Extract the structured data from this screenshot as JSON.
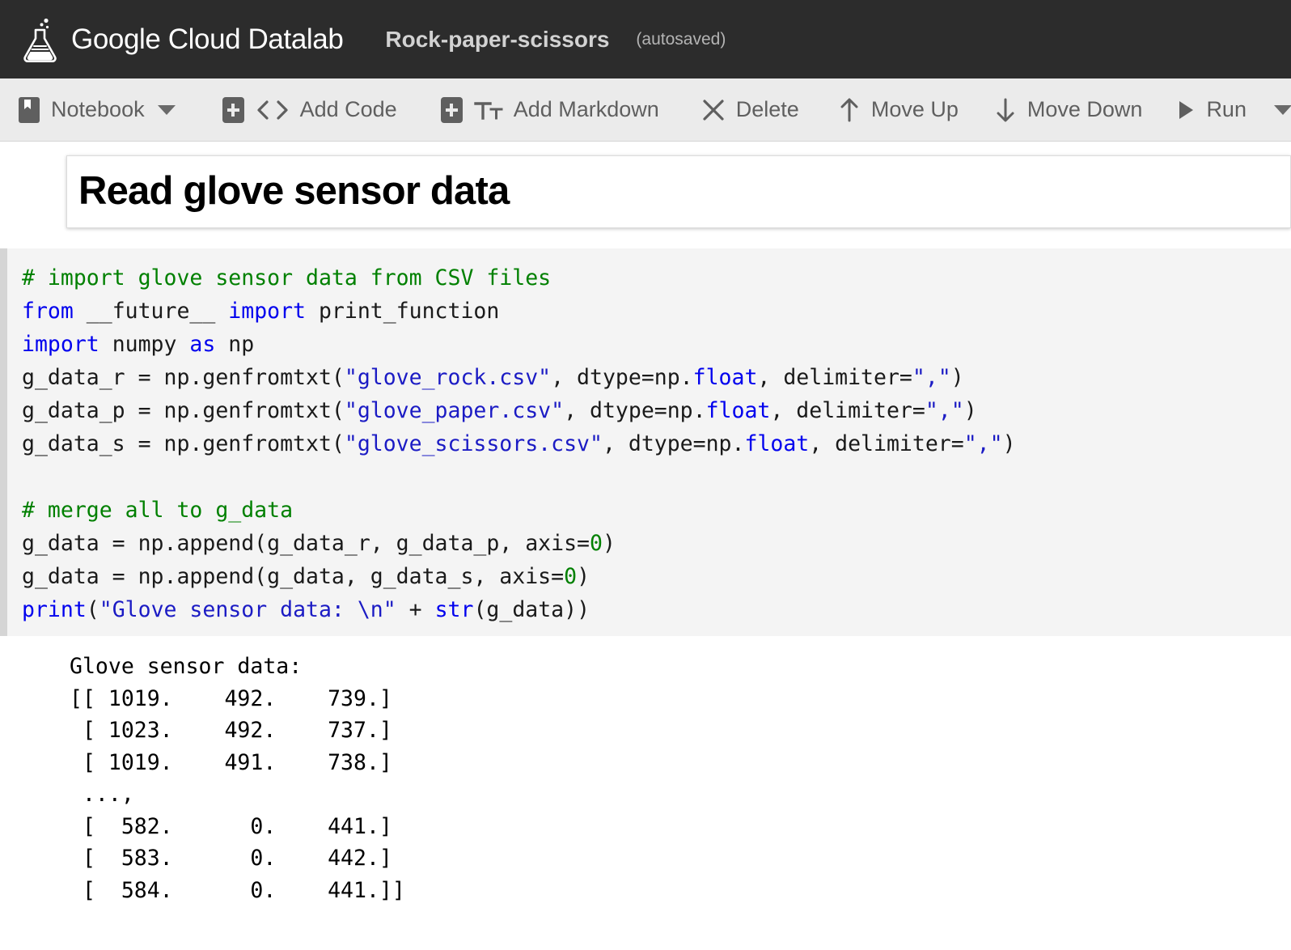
{
  "header": {
    "logo_icon": "flask-icon",
    "brand": "Google Cloud Datalab",
    "notebook_title": "Rock-paper-scissors",
    "autosaved": "(autosaved)",
    "bg_color": "#2c2c2c"
  },
  "toolbar": {
    "bg_color": "#ebebeb",
    "items": [
      {
        "label": "Notebook",
        "icon": "notebook-icon",
        "has_caret": true
      },
      {
        "label": "Add Code",
        "icon": "code-brackets-icon",
        "has_caret": false
      },
      {
        "label": "Add Markdown",
        "icon": "text-format-icon",
        "has_caret": false
      },
      {
        "label": "Delete",
        "icon": "close-x-icon",
        "has_caret": false
      },
      {
        "label": "Move Up",
        "icon": "arrow-up-icon",
        "has_caret": false
      },
      {
        "label": "Move Down",
        "icon": "arrow-down-icon",
        "has_caret": false
      },
      {
        "label": "Run",
        "icon": "play-icon",
        "has_caret": true
      }
    ]
  },
  "cells": {
    "markdown": {
      "heading": "Read glove sensor data"
    },
    "code": {
      "lines": [
        {
          "t": "comment",
          "text": "# import glove sensor data from CSV files"
        },
        {
          "t": "mixed",
          "text": "from __future__ import print_function"
        },
        {
          "t": "mixed",
          "text": "import numpy as np"
        },
        {
          "t": "mixed",
          "text": "g_data_r = np.genfromtxt(\"glove_rock.csv\", dtype=np.float, delimiter=\",\")"
        },
        {
          "t": "mixed",
          "text": "g_data_p = np.genfromtxt(\"glove_paper.csv\", dtype=np.float, delimiter=\",\")"
        },
        {
          "t": "mixed",
          "text": "g_data_s = np.genfromtxt(\"glove_scissors.csv\", dtype=np.float, delimiter=\",\")"
        },
        {
          "t": "blank",
          "text": ""
        },
        {
          "t": "comment",
          "text": "# merge all to g_data"
        },
        {
          "t": "mixed",
          "text": "g_data = np.append(g_data_r, g_data_p, axis=0)"
        },
        {
          "t": "mixed",
          "text": "g_data = np.append(g_data, g_data_s, axis=0)"
        },
        {
          "t": "mixed",
          "text": "print(\"Glove sensor data: \\n\" + str(g_data))"
        }
      ]
    },
    "output": {
      "header_line": "Glove sensor data:",
      "rows": [
        "[[ 1019.    492.    739.]",
        " [ 1023.    492.    737.]",
        " [ 1019.    491.    738.]",
        " ...,",
        " [  582.      0.    441.]",
        " [  583.      0.    442.]",
        " [  584.      0.    441.]]"
      ]
    }
  },
  "colors": {
    "comment": "#008000",
    "keyword": "#0000ee",
    "string": "#1b1bc4",
    "number": "#008000",
    "code_bg": "#f4f4f4",
    "gutter": "#d5d5d5"
  }
}
